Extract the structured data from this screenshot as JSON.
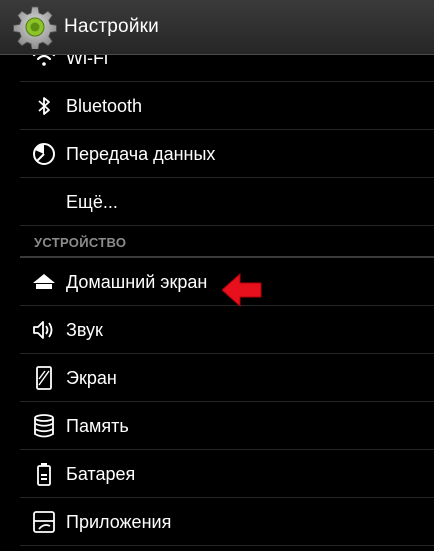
{
  "header": {
    "title": "Настройки",
    "icon": "settings-gear-icon"
  },
  "list": {
    "items_top": [
      {
        "label": "Wi-Fi",
        "icon": "wifi-icon"
      },
      {
        "label": "Bluetooth",
        "icon": "bluetooth-icon"
      },
      {
        "label": "Передача данных",
        "icon": "data-usage-icon"
      },
      {
        "label": "Ещё...",
        "icon": ""
      }
    ],
    "section_device": "УСТРОЙСТВО",
    "items_device": [
      {
        "label": "Домашний экран",
        "icon": "home-icon"
      },
      {
        "label": "Звук",
        "icon": "speaker-icon"
      },
      {
        "label": "Экран",
        "icon": "display-icon"
      },
      {
        "label": "Память",
        "icon": "storage-icon"
      },
      {
        "label": "Батарея",
        "icon": "battery-icon"
      },
      {
        "label": "Приложения",
        "icon": "apps-icon"
      }
    ]
  },
  "annotation": {
    "arrow_color": "#e8101c",
    "points_to": "Домашний экран"
  },
  "colors": {
    "background": "#000000",
    "text": "#ffffff",
    "section_header": "#8c8c8c"
  }
}
